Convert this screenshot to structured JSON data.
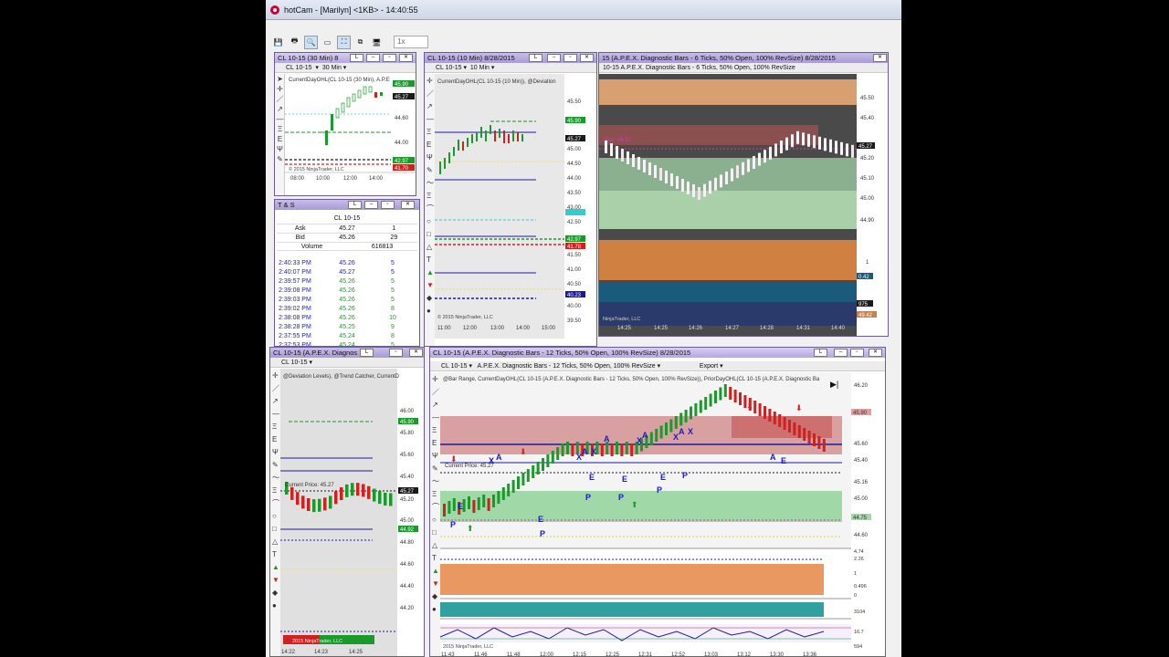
{
  "app": {
    "title": "hotCam - [Marilyn] <1KB> - 14:40:55",
    "zoom": "1x"
  },
  "colors": {
    "bull": "#1a9a2a",
    "bear": "#d02020",
    "purple": "#6c5a9a",
    "price_tag": "#1a1a1a"
  },
  "w1": {
    "title": "CL 10-15 (30 Min)  8",
    "instrument": "CL 10-15",
    "interval": "30 Min",
    "indicator": "CurrentDayOHL(CL 10-15 (30 Min), A.P.E",
    "prices": [
      "45.90",
      "45.27",
      "44.60",
      "44.00",
      "42.97",
      "41.70"
    ],
    "times": [
      "08:00",
      "10:00",
      "12:00",
      "14:00"
    ],
    "copyright": "© 2015 NinjaTrader, LLC"
  },
  "w2": {
    "title": "CL 10-15 (10 Min)  8/28/2015",
    "instrument": "CL 10-15",
    "interval": "10 Min",
    "indicator": "CurrentDayOHL(CL 10-15 (10 Min)), @Deviation",
    "prices": [
      "46.00",
      "45.90",
      "45.50",
      "45.27",
      "45.00",
      "44.50",
      "44.00",
      "43.50",
      "43.00",
      "42.50",
      "42.97",
      "41.78",
      "41.50",
      "41.00",
      "40.50",
      "40.23",
      "40.00",
      "39.50"
    ],
    "times": [
      "11:00",
      "12:00",
      "13:00",
      "14:00",
      "15:00"
    ],
    "copyright": "© 2015 NinjaTrader, LLC"
  },
  "w3": {
    "title": "15 (A.P.E.X. Diagnostic Bars - 6 Ticks, 50% Open, 100% RevSize)  8/28/2015",
    "bar": "10-15  A.P.E.X. Diagnostic Bars - 6 Ticks, 50% Open, 100% RevSize",
    "prices": [
      "45.50",
      "45.40",
      "45.27",
      "45.20",
      "45.10",
      "45.00",
      "44.90"
    ],
    "label": "Rex: 45.27",
    "sub": [
      "1",
      "0",
      "0.42",
      "975",
      "49.42"
    ],
    "times": [
      "14:25",
      "14:25",
      "14:26",
      "14:27",
      "14:28",
      "14:31",
      "14:40"
    ],
    "copyright": "NinjaTrader, LLC"
  },
  "ts": {
    "title": "T & S",
    "instrument": "CL 10-15",
    "ask_label": "Ask",
    "ask": "45.27",
    "ask_size": "1",
    "bid_label": "Bid",
    "bid": "45.26",
    "bid_size": "29",
    "vol_label": "Volume",
    "volume": "616813",
    "rows": [
      [
        "2:40:33 PM",
        "45.26",
        "5"
      ],
      [
        "2:40:07 PM",
        "45.27",
        "5"
      ],
      [
        "2:39:57 PM",
        "45.26",
        "5"
      ],
      [
        "2:39:08 PM",
        "45.26",
        "5"
      ],
      [
        "2:39:03 PM",
        "45.26",
        "5"
      ],
      [
        "2:39:02 PM",
        "45.26",
        "8"
      ],
      [
        "2:38:08 PM",
        "45.26",
        "10"
      ],
      [
        "2:38:28 PM",
        "45.25",
        "9"
      ],
      [
        "2:37:55 PM",
        "45.24",
        "8"
      ],
      [
        "2:37:53 PM",
        "45.24",
        "5"
      ],
      [
        "2:37:52 PM",
        "45.24",
        "7"
      ],
      [
        "2:37:36 PM",
        "45.23",
        "5"
      ],
      [
        "2:37:31 PM",
        "45.23",
        "5"
      ],
      [
        "2:37:31 PM",
        "45.23",
        "5"
      ]
    ]
  },
  "w5": {
    "title": "CL 10-15 (A.P.E.X. Diagnos",
    "instrument": "CL 10-15",
    "indicator": "@Deviation Levels), @Trend Catcher, CurrentD",
    "prices": [
      "46.00",
      "45.90",
      "45.80",
      "45.60",
      "45.40",
      "45.27",
      "45.20",
      "45.00",
      "44.92",
      "44.80",
      "44.60",
      "44.40",
      "44.20"
    ],
    "times": [
      "14:22",
      "14:23",
      "14:25"
    ],
    "cp": "Current Price: 45.27",
    "copyright": "2015 NinjaTrader, LLC"
  },
  "w6": {
    "title": "CL 10-15 (A.P.E.X. Diagnostic Bars - 12 Ticks, 50% Open, 100% RevSize)  8/28/2015",
    "instrument": "CL 10-15",
    "bar": "A.P.E.X. Diagnostic Bars - 12 Ticks, 50% Open, 100% RevSize",
    "export": "Export",
    "indicator": "@Bar Range,  CurrentDayOHL(CL 10-15 (A.P.E.X. Diagnostic Bars - 12 Ticks, 50% Open, 100% RevSize)),  PriorDayOHL(CL 10-15 (A.P.E.X. Diagnostic Ba",
    "cp": "Current Price: 45.27",
    "prices": [
      "46.20",
      "45.90",
      "45.60",
      "45.40",
      "45.16",
      "45.00",
      "44.75",
      "44.60"
    ],
    "sub": [
      "4.74",
      "2.26",
      "1",
      "0.496",
      "0",
      "3104",
      "16.7",
      "594"
    ],
    "times": [
      "11:43",
      "11:46",
      "11:48",
      "12:00",
      "12:15",
      "12:25",
      "12:31",
      "12:52",
      "13:03",
      "13:12",
      "13:30",
      "13:36"
    ],
    "copyright": "2015 NinjaTrader, LLC"
  }
}
